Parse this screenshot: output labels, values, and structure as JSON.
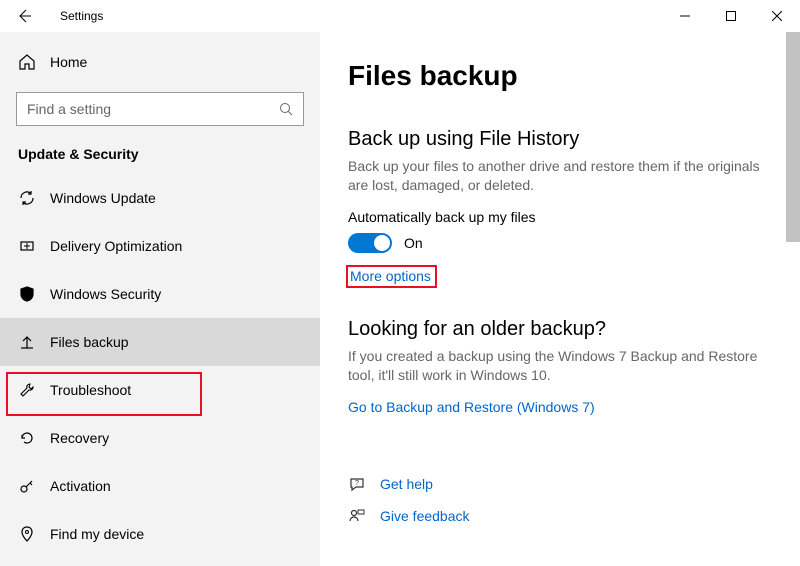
{
  "window": {
    "title": "Settings"
  },
  "sidebar": {
    "home_label": "Home",
    "search_placeholder": "Find a setting",
    "category_label": "Update & Security",
    "items": [
      {
        "label": "Windows Update"
      },
      {
        "label": "Delivery Optimization"
      },
      {
        "label": "Windows Security"
      },
      {
        "label": "Files backup"
      },
      {
        "label": "Troubleshoot"
      },
      {
        "label": "Recovery"
      },
      {
        "label": "Activation"
      },
      {
        "label": "Find my device"
      }
    ]
  },
  "main": {
    "page_title": "Files backup",
    "section1": {
      "title": "Back up using File History",
      "desc": "Back up your files to another drive and restore them if the originals are lost, damaged, or deleted.",
      "toggle_label": "Automatically back up my files",
      "toggle_state": "On",
      "more_options": "More options"
    },
    "section2": {
      "title": "Looking for an older backup?",
      "desc": "If you created a backup using the Windows 7 Backup and Restore tool, it'll still work in Windows 10.",
      "link": "Go to Backup and Restore (Windows 7)"
    },
    "footer": {
      "get_help": "Get help",
      "give_feedback": "Give feedback"
    }
  }
}
